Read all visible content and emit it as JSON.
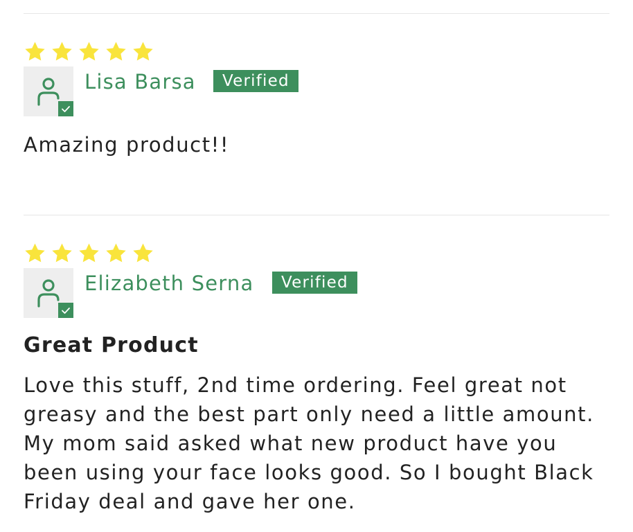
{
  "reviews": [
    {
      "rating": 5,
      "max_rating": 5,
      "author": "Lisa Barsa",
      "badge": "Verified",
      "title": "",
      "body": "Amazing product!!"
    },
    {
      "rating": 5,
      "max_rating": 5,
      "author": "Elizabeth Serna",
      "badge": "Verified",
      "title": "Great Product",
      "body": "Love this stuff, 2nd time ordering. Feel great not greasy and the best part only need a little amount. My mom said asked what new product have you been using your face looks good. So I bought Black Friday deal and gave her one."
    }
  ],
  "colors": {
    "accent_green": "#3d8f5d",
    "star_yellow": "#f9e43c",
    "avatar_bg": "#eeeeee",
    "text": "#222222",
    "divider": "#e6e6e6"
  },
  "icons": {
    "star": "star-icon",
    "avatar": "user-icon",
    "verified_check": "check-icon"
  }
}
